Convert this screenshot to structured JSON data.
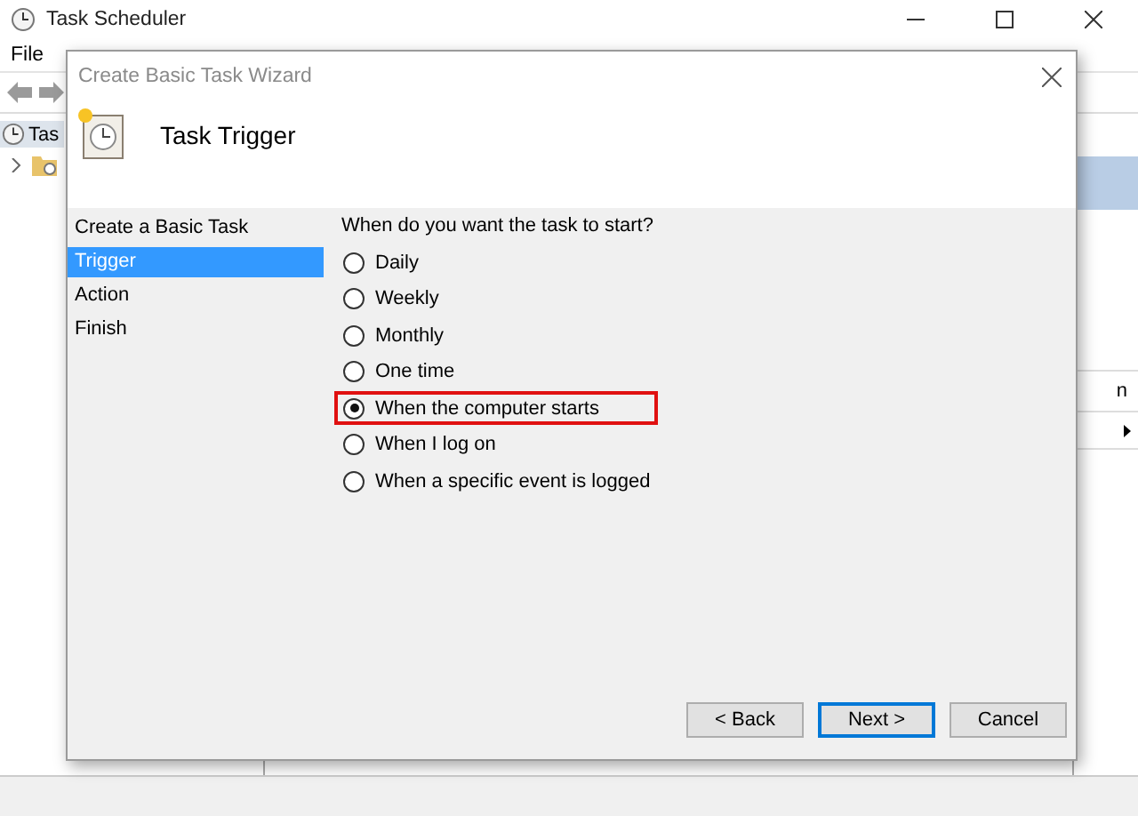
{
  "window": {
    "title": "Task Scheduler",
    "menu": [
      "File"
    ],
    "tree_items": [
      {
        "label": "Tas"
      }
    ],
    "right_pane": {
      "item": "n"
    }
  },
  "dialog": {
    "title": "Create Basic Task Wizard",
    "header": "Task Trigger",
    "steps": [
      {
        "label": "Create a Basic Task",
        "selected": false
      },
      {
        "label": "Trigger",
        "selected": true
      },
      {
        "label": "Action",
        "selected": false
      },
      {
        "label": "Finish",
        "selected": false
      }
    ],
    "question": "When do you want the task to start?",
    "options": [
      {
        "label": "Daily",
        "selected": false,
        "highlighted": false
      },
      {
        "label": "Weekly",
        "selected": false,
        "highlighted": false
      },
      {
        "label": "Monthly",
        "selected": false,
        "highlighted": false
      },
      {
        "label": "One time",
        "selected": false,
        "highlighted": false
      },
      {
        "label": "When the computer starts",
        "selected": true,
        "highlighted": true
      },
      {
        "label": "When I log on",
        "selected": false,
        "highlighted": false
      },
      {
        "label": "When a specific event is logged",
        "selected": false,
        "highlighted": false
      }
    ],
    "buttons": [
      {
        "label": "< Back",
        "default": false
      },
      {
        "label": "Next >",
        "default": true
      },
      {
        "label": "Cancel",
        "default": false
      }
    ]
  }
}
